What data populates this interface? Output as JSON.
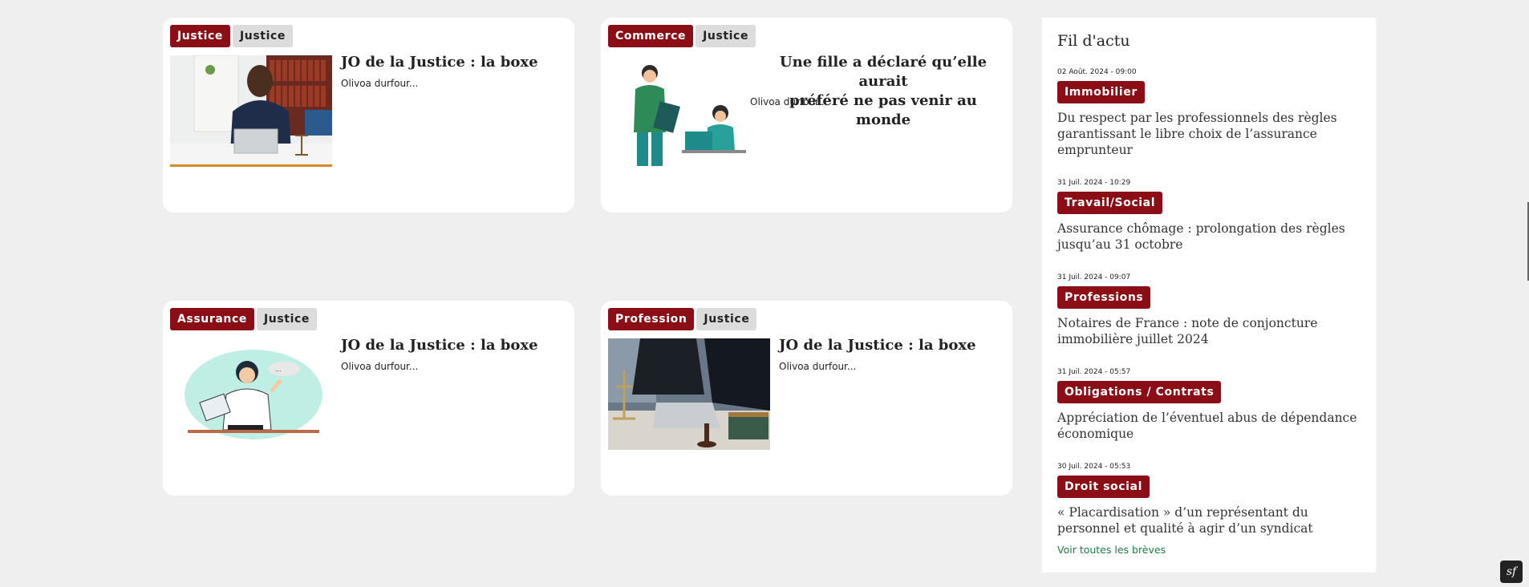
{
  "articles": [
    {
      "category": "Justice",
      "tag": "Justice",
      "title": "JO de la Justice : la boxe",
      "author": "Olivoa durfour..."
    },
    {
      "category": "Commerce",
      "tag": "Justice",
      "title_line1": "Une fille a déclaré qu’elle aurait",
      "title_line2": "préféré ne pas venir au monde",
      "author": "Olivoa durfour..."
    },
    {
      "category": "Assurance",
      "tag": "Justice",
      "title": "JO de la Justice : la boxe",
      "author": "Olivoa durfour..."
    },
    {
      "category": "Profession",
      "tag": "Justice",
      "title": "JO de la Justice : la boxe",
      "author": "Olivoa durfour..."
    }
  ],
  "sidebar": {
    "title": "Fil d'actu",
    "items": [
      {
        "date": "02 Août. 2024 - 09:00",
        "category": "Immobilier",
        "text": "Du respect par les professionnels des règles garantissant le libre choix de l’assurance emprunteur"
      },
      {
        "date": "31 Juil. 2024 - 10:29",
        "category": "Travail/Social",
        "text": "Assurance chômage : prolongation des règles jusqu’au 31 octobre"
      },
      {
        "date": "31 Juil. 2024 - 09:07",
        "category": "Professions",
        "text": "Notaires de France : note de conjoncture immobilière juillet 2024"
      },
      {
        "date": "31 Juil. 2024 - 05:57",
        "category": "Obligations / Contrats",
        "text": "Appréciation de l’éventuel abus de dépendance économique"
      },
      {
        "date": "30 Juil. 2024 - 05:53",
        "category": "Droit social",
        "text": "« Placardisation » d’un représentant du personnel et qualité à agir d’un syndicat"
      }
    ],
    "see_all": "Voir toutes les brèves"
  },
  "colors": {
    "accent": "#8b0d16",
    "link": "#1f7a4a",
    "background": "#f0eff0"
  },
  "icons": {
    "corner_badge": "symfony-icon"
  }
}
